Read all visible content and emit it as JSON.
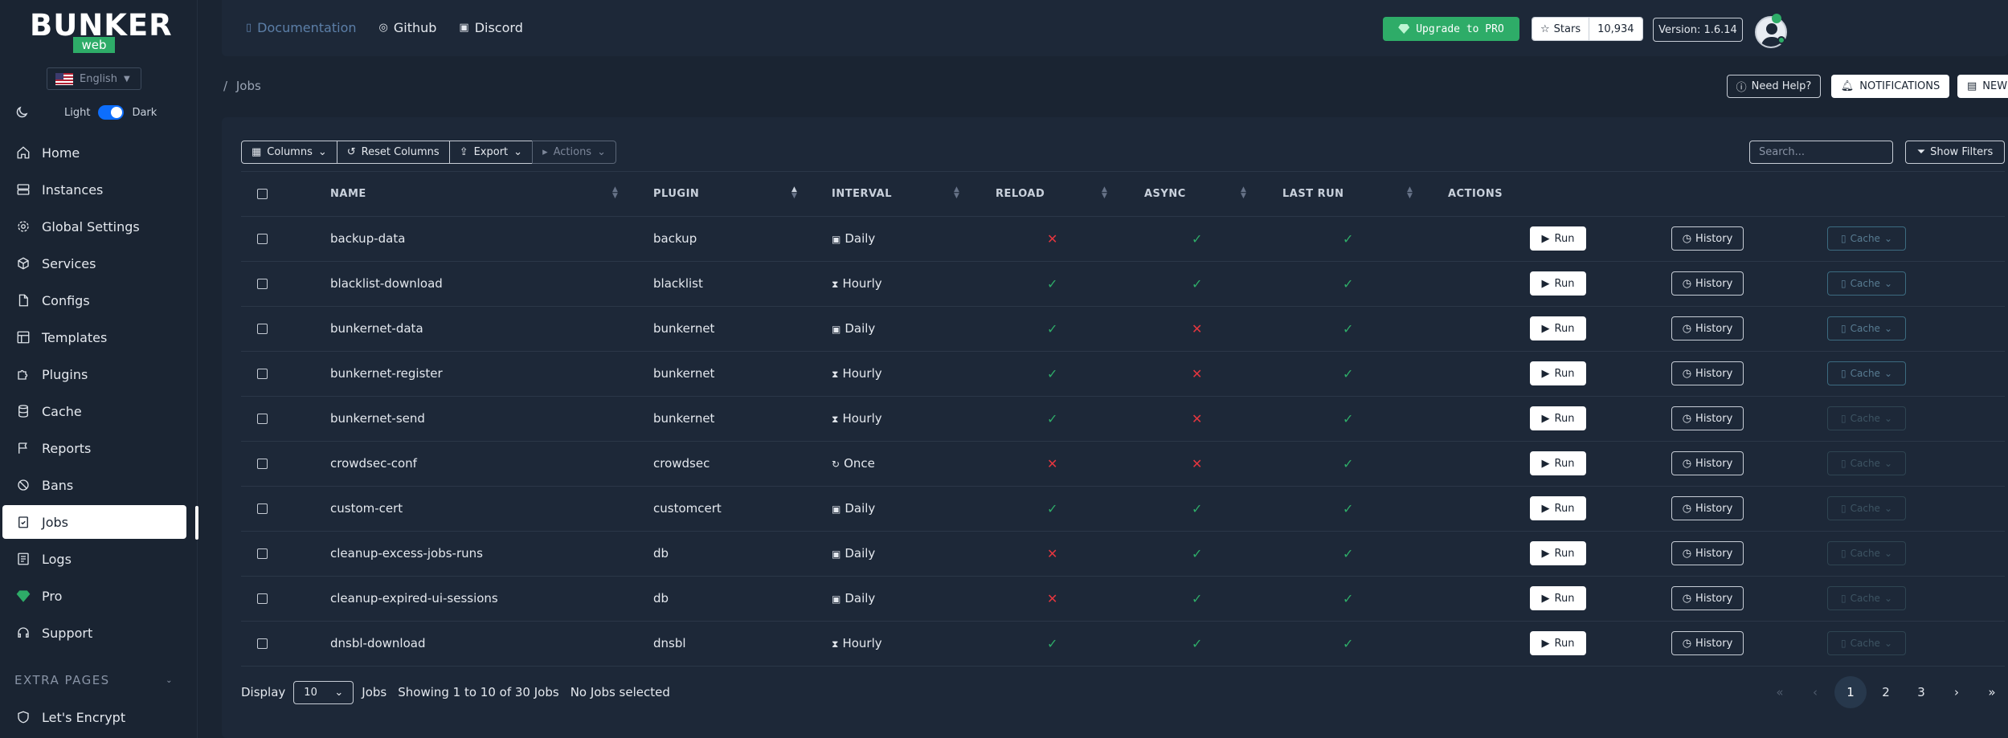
{
  "brand": {
    "logo_text": "BUNKER",
    "logo_sub": "web"
  },
  "language": {
    "selected": "English"
  },
  "theme": {
    "light_label": "Light",
    "dark_label": "Dark"
  },
  "sidebar": {
    "items": [
      {
        "label": "Home",
        "icon": "home-icon"
      },
      {
        "label": "Instances",
        "icon": "server-icon"
      },
      {
        "label": "Global Settings",
        "icon": "gear-icon"
      },
      {
        "label": "Services",
        "icon": "cube-icon"
      },
      {
        "label": "Configs",
        "icon": "file-icon"
      },
      {
        "label": "Templates",
        "icon": "layout-icon"
      },
      {
        "label": "Plugins",
        "icon": "puzzle-icon"
      },
      {
        "label": "Cache",
        "icon": "database-icon"
      },
      {
        "label": "Reports",
        "icon": "flag-icon"
      },
      {
        "label": "Bans",
        "icon": "ban-icon"
      },
      {
        "label": "Jobs",
        "icon": "clipboard-check-icon"
      },
      {
        "label": "Logs",
        "icon": "list-icon"
      },
      {
        "label": "Pro",
        "icon": "diamond-icon"
      },
      {
        "label": "Support",
        "icon": "headset-icon"
      }
    ],
    "extra_header": "EXTRA PAGES",
    "extra_items": [
      {
        "label": "Let's Encrypt",
        "icon": "shield-icon"
      }
    ]
  },
  "topbar": {
    "links": [
      {
        "label": "Documentation",
        "icon": "doc-icon"
      },
      {
        "label": "Github",
        "icon": "github-icon"
      },
      {
        "label": "Discord",
        "icon": "discord-icon"
      }
    ],
    "upgrade_label": "Upgrade to PRO",
    "stars_label": "Stars",
    "stars_count": "10,934",
    "version": "Version: 1.6.14"
  },
  "breadcrumb": {
    "separator": "/",
    "current": "Jobs"
  },
  "header_actions": {
    "help": "Need Help?",
    "notifications": "NOTIFICATIONS",
    "news": "NEW"
  },
  "toolbar": {
    "columns": "Columns",
    "reset": "Reset Columns",
    "export": "Export",
    "actions": "Actions",
    "search_placeholder": "Search...",
    "filters": "Show Filters"
  },
  "table": {
    "headers": [
      "NAME",
      "PLUGIN",
      "INTERVAL",
      "RELOAD",
      "ASYNC",
      "LAST RUN",
      "ACTIONS"
    ],
    "run_label": "Run",
    "history_label": "History",
    "cache_label": "Cache",
    "rows": [
      {
        "name": "backup-data",
        "plugin": "backup",
        "interval": "Daily",
        "interval_icon": "calendar-icon",
        "reload": false,
        "async": true,
        "last_run": true,
        "cache_enabled": true
      },
      {
        "name": "blacklist-download",
        "plugin": "blacklist",
        "interval": "Hourly",
        "interval_icon": "hourglass-icon",
        "reload": true,
        "async": true,
        "last_run": true,
        "cache_enabled": true
      },
      {
        "name": "bunkernet-data",
        "plugin": "bunkernet",
        "interval": "Daily",
        "interval_icon": "calendar-icon",
        "reload": true,
        "async": false,
        "last_run": true,
        "cache_enabled": true
      },
      {
        "name": "bunkernet-register",
        "plugin": "bunkernet",
        "interval": "Hourly",
        "interval_icon": "hourglass-icon",
        "reload": true,
        "async": false,
        "last_run": true,
        "cache_enabled": true
      },
      {
        "name": "bunkernet-send",
        "plugin": "bunkernet",
        "interval": "Hourly",
        "interval_icon": "hourglass-icon",
        "reload": true,
        "async": false,
        "last_run": true,
        "cache_enabled": false
      },
      {
        "name": "crowdsec-conf",
        "plugin": "crowdsec",
        "interval": "Once",
        "interval_icon": "refresh-icon",
        "reload": false,
        "async": false,
        "last_run": true,
        "cache_enabled": false
      },
      {
        "name": "custom-cert",
        "plugin": "customcert",
        "interval": "Daily",
        "interval_icon": "calendar-icon",
        "reload": true,
        "async": true,
        "last_run": true,
        "cache_enabled": false
      },
      {
        "name": "cleanup-excess-jobs-runs",
        "plugin": "db",
        "interval": "Daily",
        "interval_icon": "calendar-icon",
        "reload": false,
        "async": true,
        "last_run": true,
        "cache_enabled": false
      },
      {
        "name": "cleanup-expired-ui-sessions",
        "plugin": "db",
        "interval": "Daily",
        "interval_icon": "calendar-icon",
        "reload": false,
        "async": true,
        "last_run": true,
        "cache_enabled": false
      },
      {
        "name": "dnsbl-download",
        "plugin": "dnsbl",
        "interval": "Hourly",
        "interval_icon": "hourglass-icon",
        "reload": true,
        "async": true,
        "last_run": true,
        "cache_enabled": false
      }
    ]
  },
  "footer": {
    "display_label": "Display",
    "page_size": "10",
    "unit": "Jobs",
    "showing": "Showing 1 to 10 of 30 Jobs",
    "selected": "No Jobs selected"
  },
  "pagination": {
    "pages": [
      "1",
      "2",
      "3"
    ],
    "current": "1",
    "next": "›",
    "last": "»",
    "first": "«",
    "prev": "‹"
  },
  "colors": {
    "accent_green": "#2eac68",
    "error_red": "#e4363f",
    "bg": "#1a2432",
    "panel": "#1d2838"
  }
}
